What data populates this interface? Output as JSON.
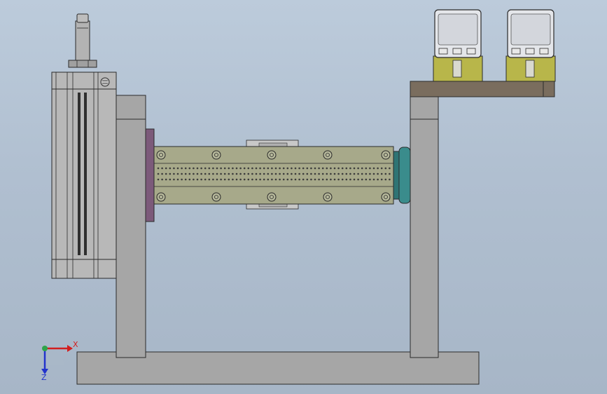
{
  "colors": {
    "background_top": "#bccbdb",
    "background_bottom": "#a7b6c7",
    "frame_gray": "#a6a6a6",
    "frame_edge": "#2a2a2a",
    "plate_olive": "#a7a98a",
    "hole_dark": "#3b3b3b",
    "flange_purple": "#7c5a7a",
    "flange_teal": "#3a8c8c",
    "bracket_brown": "#7a6d5e",
    "fitting_yellow": "#b8b64a",
    "axis_x": "#d21e1e",
    "axis_y": "#2ea44a",
    "axis_z": "#2233cc"
  },
  "triad": {
    "x_label": "X",
    "z_label": "Z"
  },
  "icons": {
    "cylinder_badge": "hex-nut-icon"
  }
}
